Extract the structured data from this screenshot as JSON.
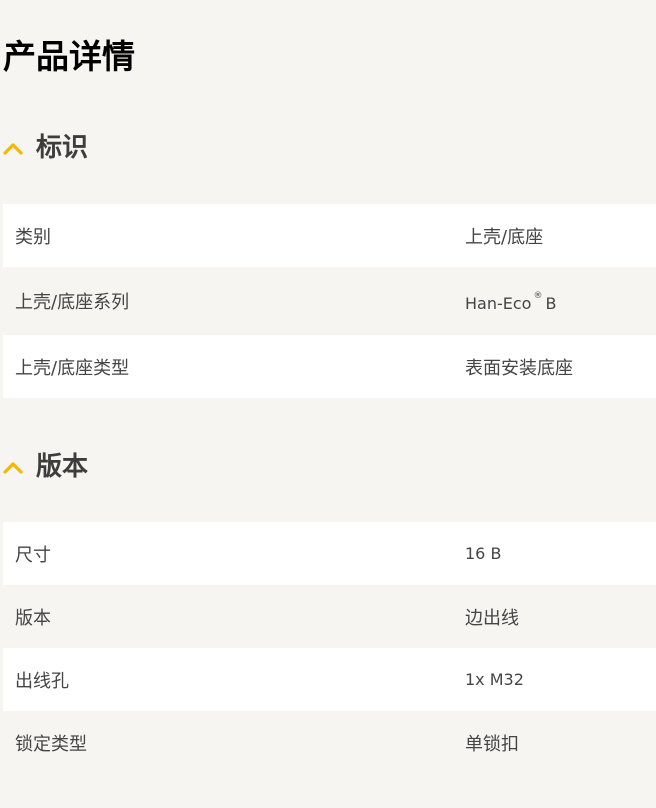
{
  "page": {
    "title": "产品详情"
  },
  "colors": {
    "accent": "#f5b800",
    "row_white": "#ffffff",
    "row_grey": "#f6f5f2"
  },
  "sections": [
    {
      "icon": "chevron-up-icon",
      "title": "标识",
      "rows": [
        {
          "label": "类别",
          "value": "上壳/底座"
        },
        {
          "label": "上壳/底座系列",
          "value_prefix": "Han-Eco",
          "value_sup": "®",
          "value_suffix": "B"
        },
        {
          "label": "上壳/底座类型",
          "value": "表面安装底座"
        }
      ]
    },
    {
      "icon": "chevron-up-icon",
      "title": "版本",
      "rows": [
        {
          "label": "尺寸",
          "value": "16 B"
        },
        {
          "label": "版本",
          "value": "边出线"
        },
        {
          "label": "出线孔",
          "value": "1x M32"
        },
        {
          "label": "锁定类型",
          "value": "单锁扣"
        }
      ]
    }
  ]
}
